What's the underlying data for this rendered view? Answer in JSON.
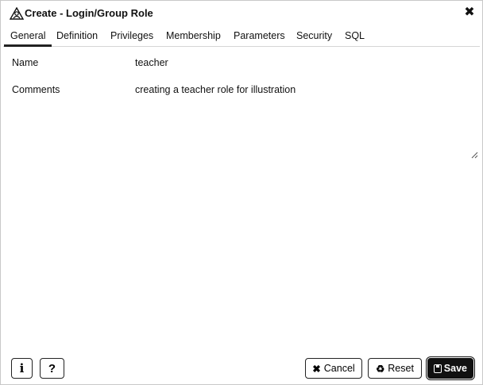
{
  "dialog": {
    "title": "Create - Login/Group Role",
    "title_icon": "role-icon",
    "close_glyph": "✖"
  },
  "tabs": [
    {
      "label": "General",
      "active": true
    },
    {
      "label": "Definition",
      "active": false
    },
    {
      "label": "Privileges",
      "active": false
    },
    {
      "label": "Membership",
      "active": false
    },
    {
      "label": "Parameters",
      "active": false
    },
    {
      "label": "Security",
      "active": false
    },
    {
      "label": "SQL",
      "active": false
    }
  ],
  "form": {
    "name_label": "Name",
    "name_value": "teacher",
    "comments_label": "Comments",
    "comments_value": "creating a teacher role for illustration"
  },
  "footer": {
    "info_label": "i",
    "help_label": "?",
    "cancel_label": "Cancel",
    "reset_label": "Reset",
    "save_label": "Save"
  },
  "colors": {
    "accent": "#111111",
    "border": "#c8c8c8"
  }
}
